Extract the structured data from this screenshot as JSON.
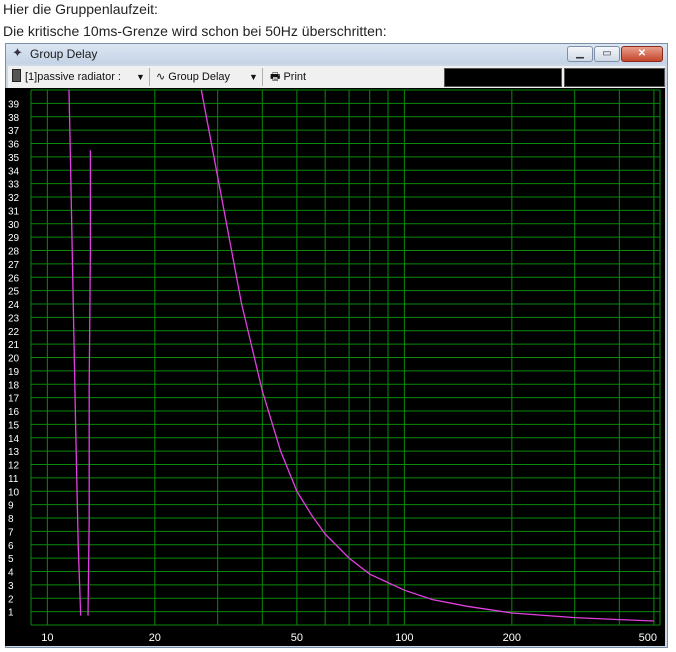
{
  "intro": {
    "line1": "Hier die Gruppenlaufzeit:",
    "line2": "Die kritische 10ms-Grenze wird schon bei 50Hz überschritten:"
  },
  "window": {
    "title": "Group Delay",
    "title_icon": "crosshair-icon",
    "controls": {
      "minimize": "minimize-icon",
      "maximize": "maximize-icon",
      "close": "close-icon"
    }
  },
  "toolbar": {
    "driver_select": "[1]passive radiator :",
    "view_select": "Group Delay",
    "print_label": "Print"
  },
  "colors": {
    "plot_bg": "#000000",
    "grid": "#0a8a0a",
    "curve": "#e040e0",
    "label": "#ffffff"
  },
  "chart_data": {
    "type": "line",
    "title": "",
    "xlabel": "",
    "ylabel": "",
    "x_scale": "log",
    "xlim": [
      9,
      520
    ],
    "ylim": [
      0,
      40
    ],
    "x_ticks": [
      10,
      20,
      50,
      100,
      200,
      500
    ],
    "y_ticks": [
      1,
      2,
      3,
      4,
      5,
      6,
      7,
      8,
      9,
      10,
      11,
      12,
      13,
      14,
      15,
      16,
      17,
      18,
      19,
      20,
      21,
      22,
      23,
      24,
      25,
      26,
      27,
      28,
      29,
      30,
      31,
      32,
      33,
      34,
      35,
      36,
      37,
      38,
      39
    ],
    "grid": true,
    "series": [
      {
        "x": [
          11.5,
          11.6,
          11.8,
          12.0,
          12.2,
          12.4
        ],
        "y": [
          40,
          35,
          25,
          15,
          6,
          0.7
        ]
      },
      {
        "x": [
          13.2,
          13.2,
          13.1,
          13.1,
          13.0
        ],
        "y": [
          35.5,
          28,
          18,
          8,
          0.7
        ]
      },
      {
        "x": [
          27,
          30,
          35,
          40,
          45,
          50,
          55,
          60,
          70,
          80,
          100,
          120,
          150,
          200,
          300,
          400,
          500
        ],
        "y": [
          40,
          33.5,
          24,
          17.5,
          13,
          10,
          8.2,
          6.8,
          5,
          3.8,
          2.6,
          1.9,
          1.4,
          0.9,
          0.55,
          0.4,
          0.3
        ]
      }
    ]
  }
}
